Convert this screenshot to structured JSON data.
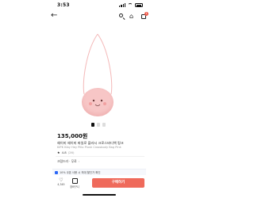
{
  "status": {
    "time": "3:53"
  },
  "nav": {
    "back_icon": "back-arrow-icon",
    "actions": [
      "search-icon",
      "home-icon",
      "cart-icon"
    ],
    "cart_badge": "1"
  },
  "product": {
    "price": "135,000원",
    "title": "헤이미 헤이미 파일로 플러시 크로스바디백 핑크",
    "subtitle": "KIPK Kiby Hey Pillo Plush Crossbody Bag Pink",
    "rating": "4.8",
    "review_count": "(26)",
    "shipping": "크림드라 · 무료",
    "image_counter": "1/4"
  },
  "coupon": {
    "text": "10% 쿠폰 사용 시 최대 할인가 확인"
  },
  "bottom_bar": {
    "wish_count": "4,345",
    "cart_label": "장바구니",
    "buy_label": "구매하기"
  },
  "colors": {
    "accent": "#ef6a5b",
    "bag_pink": "#f7c6c6",
    "coupon_blue": "#2b67f6"
  }
}
